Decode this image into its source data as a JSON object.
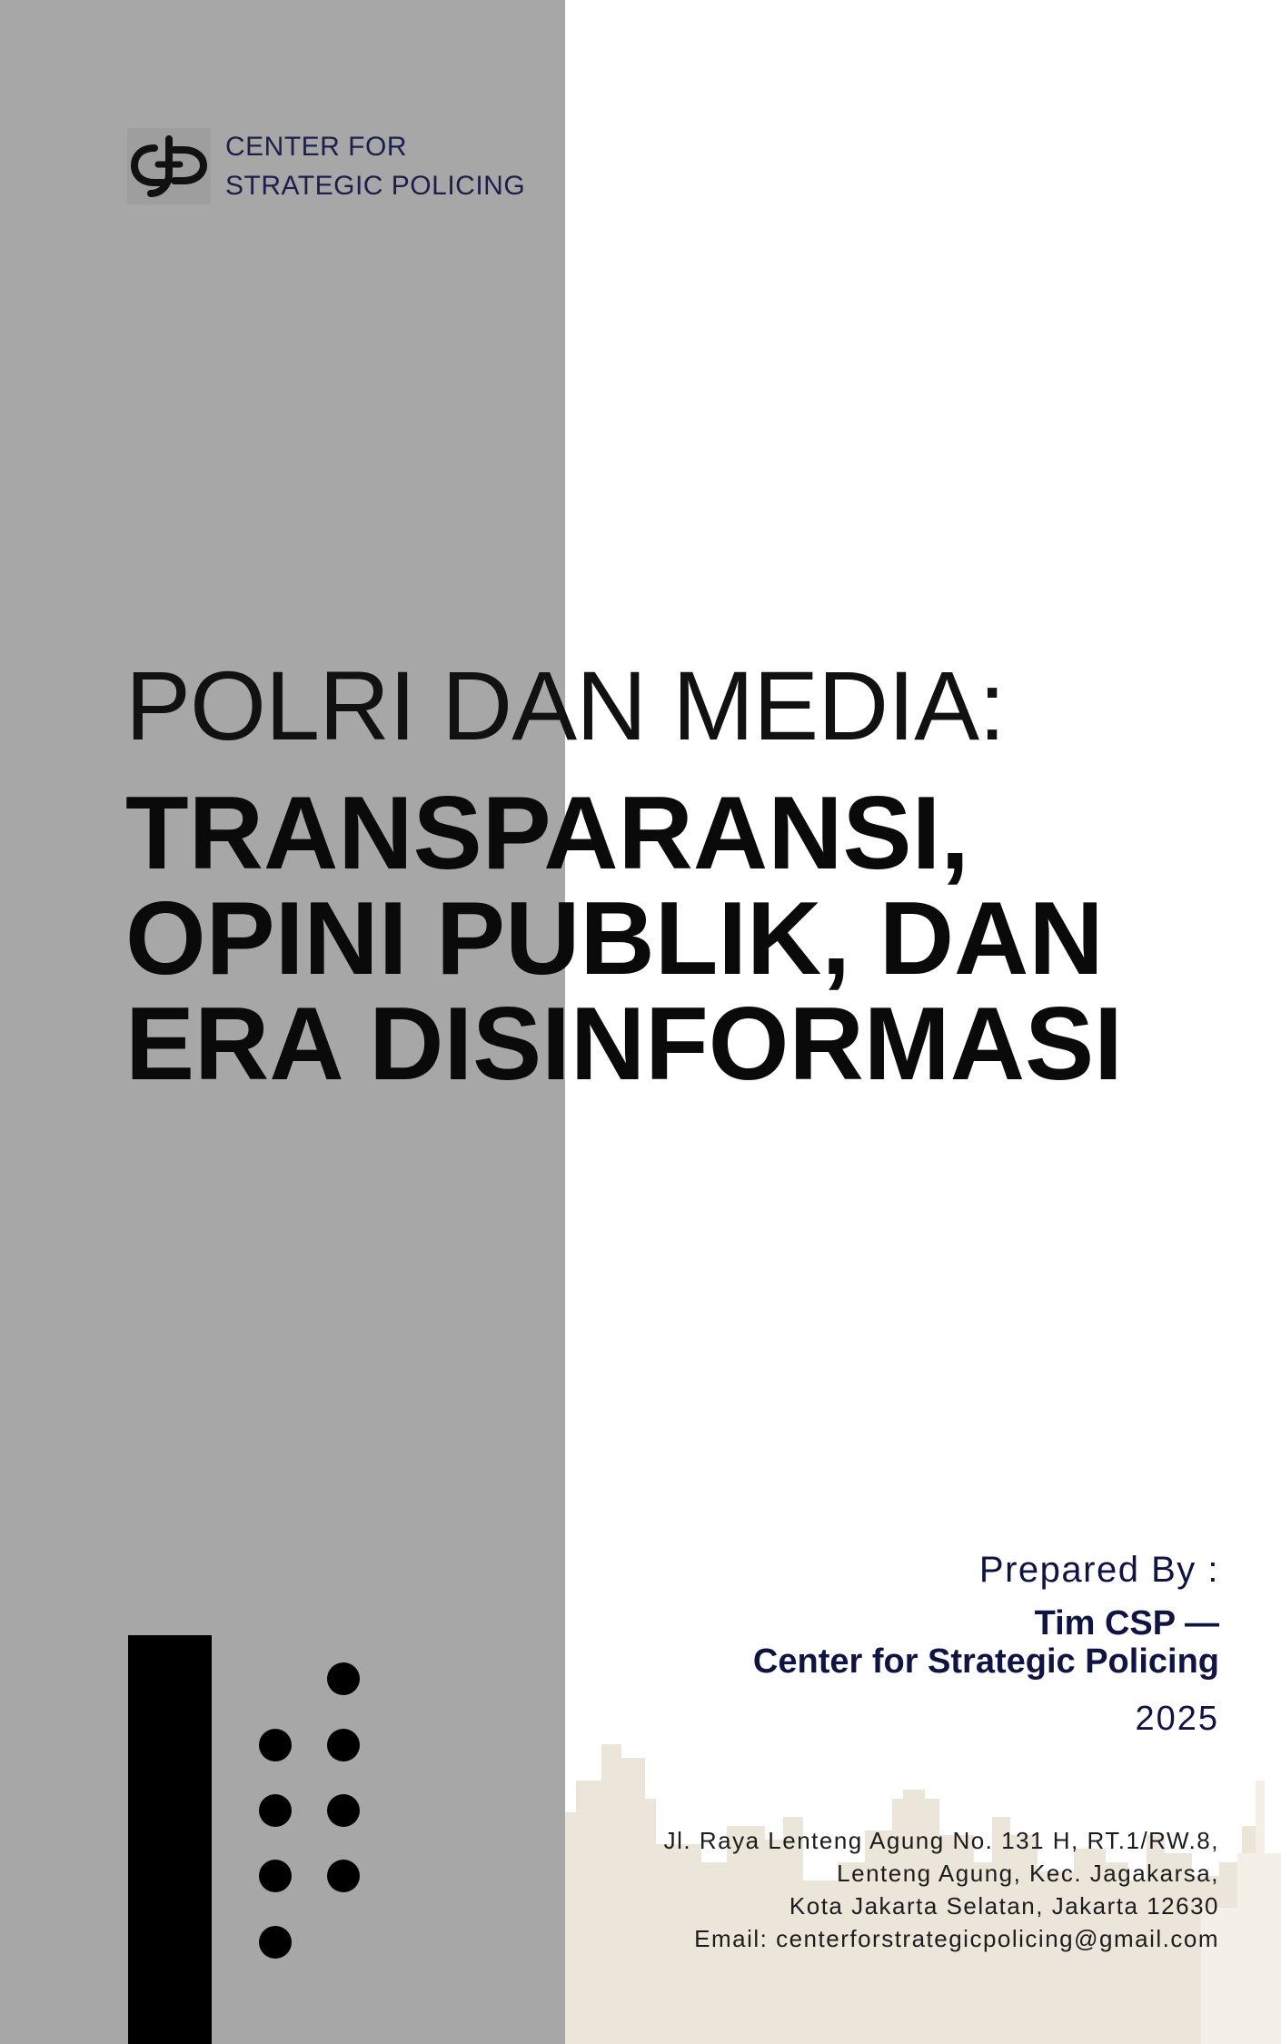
{
  "logo": {
    "line1": "CENTER FOR",
    "line2": "STRATEGIC POLICING",
    "icon": "csp-logo-icon"
  },
  "title": {
    "light": "POLRI DAN MEDIA:",
    "bold_lines": [
      "TRANSPARANSI,",
      "OPINI PUBLIK, DAN",
      "ERA DISINFORMASI"
    ]
  },
  "prepared": {
    "label": "Prepared By :",
    "team": "Tim CSP —",
    "org": "Center for Strategic Policing",
    "year": "2025"
  },
  "address": {
    "line1": "Jl. Raya Lenteng Agung No. 131 H, RT.1/RW.8,",
    "line2": "Lenteng Agung, Kec. Jagakarsa,",
    "line3": "Kota Jakarta Selatan, Jakarta 12630",
    "line4": "Email: centerforstrategicpolicing@gmail.com"
  },
  "colors": {
    "left_panel": "#a7a7a7",
    "navy_text": "#0f1442",
    "skyline": "#ece6da"
  }
}
